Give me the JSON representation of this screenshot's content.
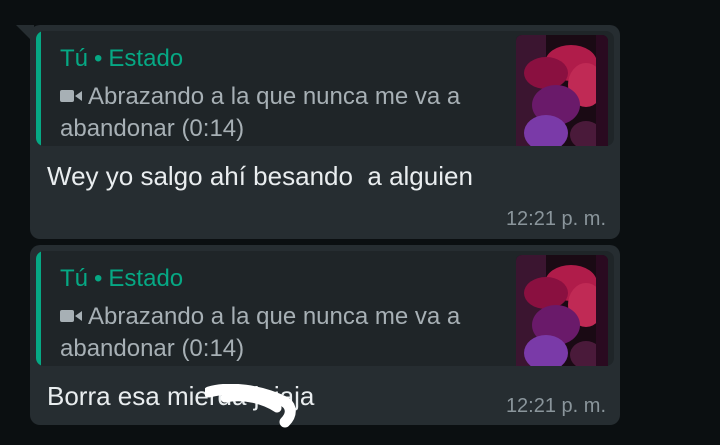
{
  "messages": [
    {
      "quote": {
        "author": "Tú",
        "separator": "•",
        "type": "Estado",
        "icon": "video-camera-icon",
        "caption": "Abrazando a la que nunca me va a abandonar (0:14)"
      },
      "text": "Wey yo salgo ahí besando  a alguien",
      "time": "12:21 p. m."
    },
    {
      "quote": {
        "author": "Tú",
        "separator": "•",
        "type": "Estado",
        "icon": "video-camera-icon",
        "caption": "Abrazando a la que nunca me va a abandonar (0:14)"
      },
      "text": "Borra esa mierda jajaja",
      "time": "12:21 p. m."
    }
  ],
  "colors": {
    "background": "#0b0f11",
    "bubble": "#262d31",
    "quote_background": "#1f2528",
    "accent": "#06a884",
    "message_text": "#e9edef",
    "secondary_text": "#a7b0b5",
    "timestamp": "#8a959b"
  }
}
